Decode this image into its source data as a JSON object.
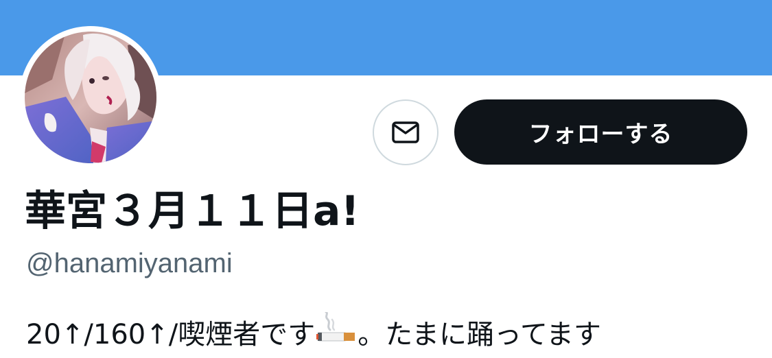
{
  "profile": {
    "display_name": "華宮３月１１日a!",
    "handle": "@hanamiyanami",
    "bio_before_icon": "20↑/160↑/喫煙者です",
    "bio_icon": "cigarette-icon",
    "bio_after_icon": "。たまに踊ってます"
  },
  "actions": {
    "message_icon": "envelope-icon",
    "follow_label": "フォローする"
  },
  "colors": {
    "banner": "#4a99e9",
    "follow_button_bg": "#0f1419",
    "handle_text": "#536471",
    "button_border": "#cfd9de"
  }
}
